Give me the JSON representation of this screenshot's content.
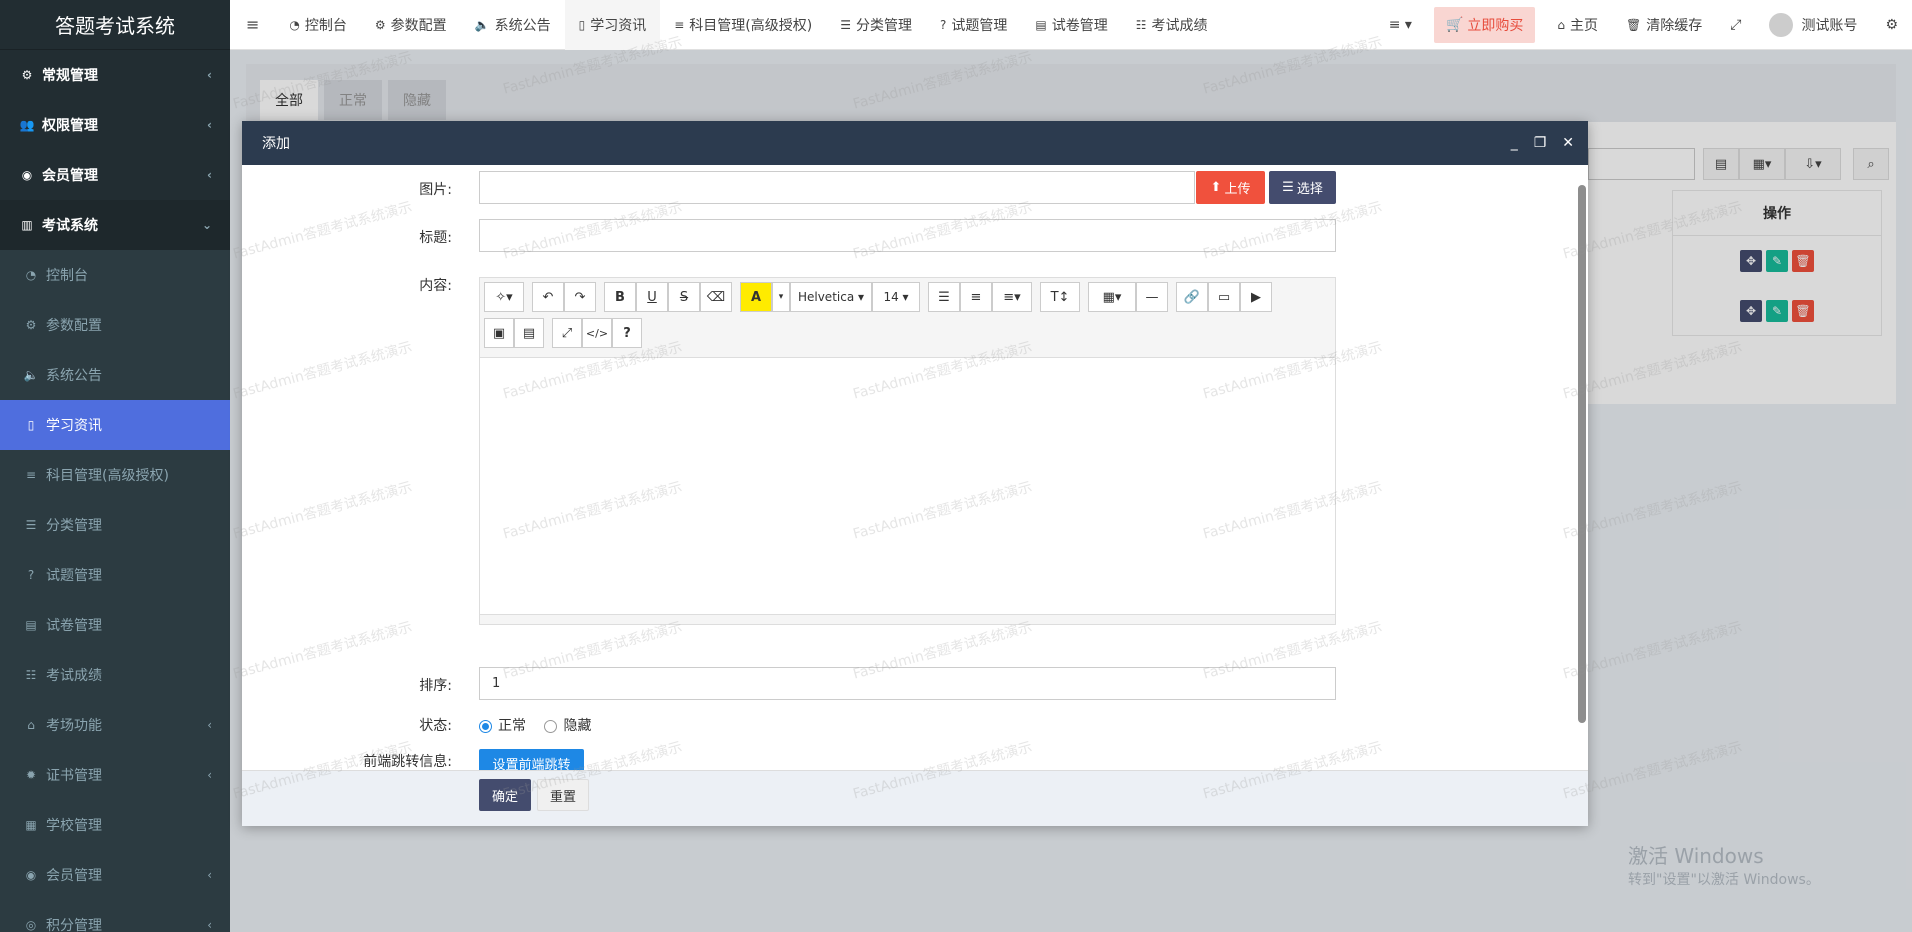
{
  "app": {
    "title": "答题考试系统"
  },
  "sidebar": {
    "items": [
      {
        "label": "常规管理",
        "icon": "cogs-icon",
        "level": "top"
      },
      {
        "label": "权限管理",
        "icon": "users-icon",
        "level": "top"
      },
      {
        "label": "会员管理",
        "icon": "user-circle-icon",
        "level": "top"
      },
      {
        "label": "考试系统",
        "icon": "book-icon",
        "level": "top-open"
      },
      {
        "label": "控制台",
        "icon": "dashboard-icon",
        "level": "sub"
      },
      {
        "label": "参数配置",
        "icon": "cogs-icon",
        "level": "sub"
      },
      {
        "label": "系统公告",
        "icon": "volume-icon",
        "level": "sub"
      },
      {
        "label": "学习资讯",
        "icon": "map-icon",
        "level": "sub-active"
      },
      {
        "label": "科目管理(高级授权)",
        "icon": "list-icon",
        "level": "sub"
      },
      {
        "label": "分类管理",
        "icon": "align-icon",
        "level": "sub"
      },
      {
        "label": "试题管理",
        "icon": "question-icon",
        "level": "sub"
      },
      {
        "label": "试卷管理",
        "icon": "newspaper-icon",
        "level": "sub"
      },
      {
        "label": "考试成绩",
        "icon": "list-ul-icon",
        "level": "sub"
      },
      {
        "label": "考场功能",
        "icon": "home-icon",
        "level": "sub"
      },
      {
        "label": "证书管理",
        "icon": "certificate-icon",
        "level": "sub"
      },
      {
        "label": "学校管理",
        "icon": "building-icon",
        "level": "sub"
      },
      {
        "label": "会员管理",
        "icon": "user-circle-icon",
        "level": "sub"
      },
      {
        "label": "积分管理",
        "icon": "coin-icon",
        "level": "sub"
      }
    ]
  },
  "header": {
    "tabs": [
      {
        "label": "控制台",
        "icon": "dashboard-icon"
      },
      {
        "label": "参数配置",
        "icon": "cogs-icon"
      },
      {
        "label": "系统公告",
        "icon": "volume-icon"
      },
      {
        "label": "学习资讯",
        "icon": "map-icon"
      },
      {
        "label": "科目管理(高级授权)",
        "icon": "list-icon"
      },
      {
        "label": "分类管理",
        "icon": "align-icon"
      },
      {
        "label": "试题管理",
        "icon": "question-icon"
      },
      {
        "label": "试卷管理",
        "icon": "newspaper-icon"
      },
      {
        "label": "考试成绩",
        "icon": "list-ul-icon"
      }
    ],
    "buy": "立即购买",
    "home": "主页",
    "clear_cache": "清除缓存",
    "user": "测试账号"
  },
  "content": {
    "tabs": [
      "全部",
      "正常",
      "隐藏"
    ],
    "table_header_action": "操作"
  },
  "watermark": "FastAdmin答题考试系统演示",
  "modal": {
    "title": "添加",
    "fields": {
      "image_label": "图片:",
      "title_label": "标题:",
      "content_label": "内容:",
      "sort_label": "排序:",
      "sort_value": "1",
      "status_label": "状态:",
      "status_options": [
        "正常",
        "隐藏"
      ],
      "jump_label": "前端跳转信息:"
    },
    "buttons": {
      "upload": "上传",
      "select": "选择",
      "jump": "设置前端跳转",
      "confirm": "确定",
      "reset": "重置"
    },
    "editor": {
      "font": "Helvetica",
      "size": "14"
    }
  },
  "windows": {
    "line1": "激活 Windows",
    "line2": "转到\"设置\"以激活 Windows。"
  },
  "colors": {
    "sidebar_bg": "#222d32",
    "active": "#4f6ede",
    "modal_header": "#2c3b4f",
    "danger": "#f0513d",
    "primary_dark": "#444c6e",
    "blue": "#1e88e5",
    "green": "#18bc9c"
  }
}
